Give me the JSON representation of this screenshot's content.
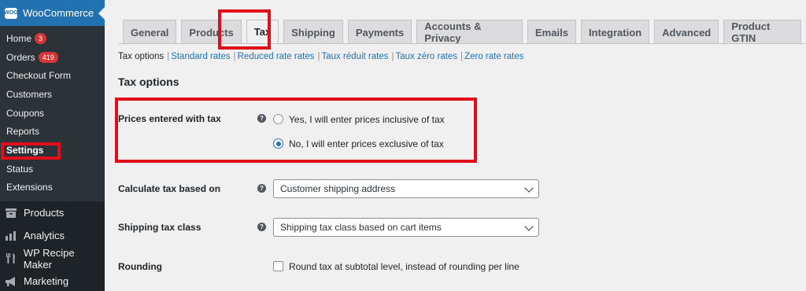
{
  "sidebar": {
    "header_logo": "WOO",
    "header_title": "WooCommerce",
    "submenu": [
      {
        "label": "Home",
        "badge": "3"
      },
      {
        "label": "Orders",
        "badge": "419"
      },
      {
        "label": "Checkout Form"
      },
      {
        "label": "Customers"
      },
      {
        "label": "Coupons"
      },
      {
        "label": "Reports"
      },
      {
        "label": "Settings",
        "active": true
      },
      {
        "label": "Status"
      },
      {
        "label": "Extensions"
      }
    ],
    "menu": [
      {
        "label": "Products",
        "icon": "products-icon"
      },
      {
        "label": "Analytics",
        "icon": "analytics-icon"
      },
      {
        "label": "WP Recipe Maker",
        "icon": "recipe-icon"
      },
      {
        "label": "Marketing",
        "icon": "marketing-icon"
      }
    ]
  },
  "tabs": [
    "General",
    "Products",
    "Tax",
    "Shipping",
    "Payments",
    "Accounts & Privacy",
    "Emails",
    "Integration",
    "Advanced",
    "Product GTIN"
  ],
  "active_tab": "Tax",
  "subsub": {
    "current": "Tax options",
    "links": [
      "Standard rates",
      "Reduced rate rates",
      "Taux réduit rates",
      "Taux zéro rates",
      "Zero rate rates"
    ]
  },
  "section_title": "Tax options",
  "prices_with_tax": {
    "label": "Prices entered with tax",
    "help": "?",
    "options": [
      {
        "label": "Yes, I will enter prices inclusive of tax",
        "checked": false
      },
      {
        "label": "No, I will enter prices exclusive of tax",
        "checked": true
      }
    ]
  },
  "calc_based_on": {
    "label": "Calculate tax based on",
    "help": "?",
    "value": "Customer shipping address"
  },
  "shipping_tax_class": {
    "label": "Shipping tax class",
    "help": "?",
    "value": "Shipping tax class based on cart items"
  },
  "rounding": {
    "label": "Rounding",
    "checkbox_label": "Round tax at subtotal level, instead of rounding per line",
    "checked": false
  },
  "colors": {
    "highlight": "#e10d1a",
    "accent": "#2271b1",
    "sidebar": "#1d2327"
  }
}
